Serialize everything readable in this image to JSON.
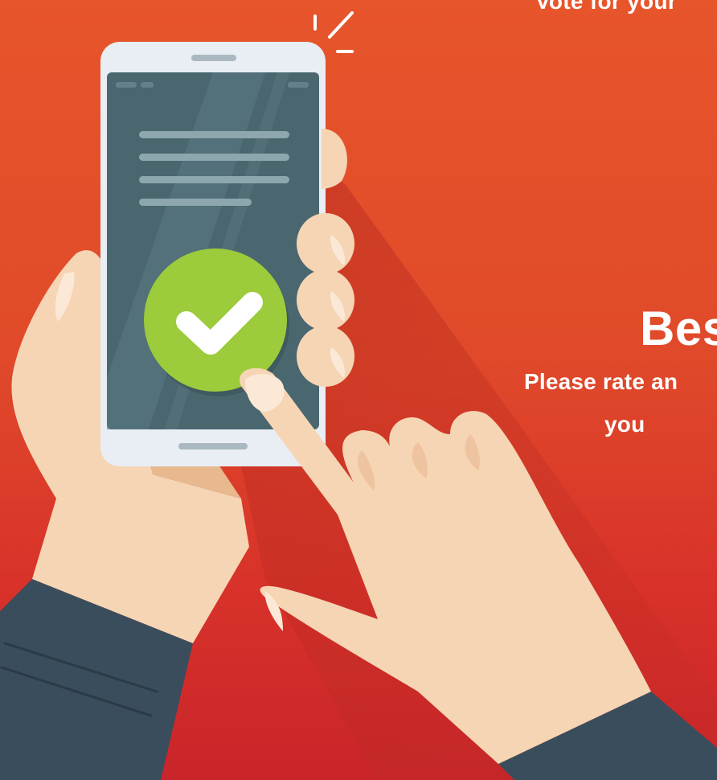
{
  "top_text": "Vote for your",
  "best_heading": "Bes",
  "rate_line_1": "Please rate an",
  "rate_line_2": "you",
  "colors": {
    "background_top": "#e7552b",
    "background_bottom": "#c9252a",
    "phone_body": "#e8eef3",
    "phone_screen": "#4a6770",
    "check_badge": "#9ccb3b",
    "skin": "#f6d5b4",
    "sleeve": "#3a4d5c",
    "text": "#ffffff"
  },
  "icons": {
    "check": "check-icon",
    "burst": "burst-lines-icon"
  }
}
